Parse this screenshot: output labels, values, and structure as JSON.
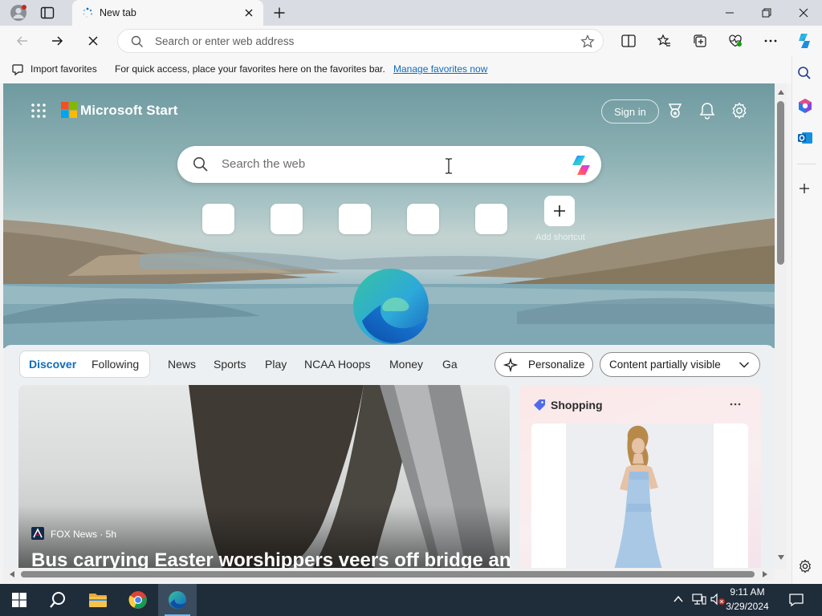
{
  "browser": {
    "tab_title": "New tab",
    "address_placeholder": "Search or enter web address",
    "favorites": {
      "import_label": "Import favorites",
      "hint_text": "For quick access, place your favorites here on the favorites bar.",
      "manage_link": "Manage favorites now"
    }
  },
  "newtab": {
    "brand": "Microsoft Start",
    "sign_in": "Sign in",
    "search_placeholder": "Search the web",
    "add_shortcut": "Add shortcut",
    "feed_tabs": [
      "Discover",
      "Following"
    ],
    "feed_nav": [
      "News",
      "Sports",
      "Play",
      "NCAA Hoops",
      "Money",
      "Ga"
    ],
    "personalize": "Personalize",
    "content_visibility": "Content partially visible",
    "news_card": {
      "source": "FOX News · 5h",
      "headline": "Bus carrying Easter worshippers veers off bridge and"
    },
    "shopping_card": {
      "title": "Shopping"
    }
  },
  "taskbar": {
    "time": "9:11 AM",
    "date": "3/29/2024"
  },
  "colors": {
    "accent": "#0f6cbd",
    "taskbar": "#1f2c3a",
    "link": "#0f6cbd"
  }
}
